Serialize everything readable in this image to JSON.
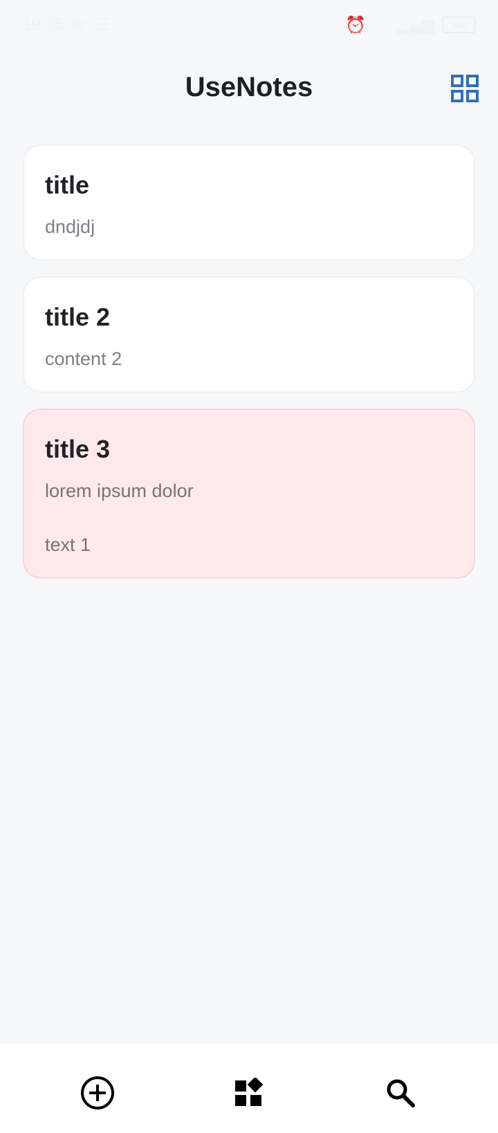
{
  "status_bar": {
    "time": "19:35",
    "battery": "100"
  },
  "header": {
    "title": "UseNotes",
    "layout_toggle_icon": "grid-view-icon",
    "accent_color": "#2f6fba"
  },
  "notes": [
    {
      "title": "title",
      "content": "dndjdj",
      "extra": "",
      "color": "#ffffff"
    },
    {
      "title": "title 2",
      "content": "content 2",
      "extra": "",
      "color": "#ffffff"
    },
    {
      "title": "title 3",
      "content": "lorem ipsum dolor",
      "extra": "text 1",
      "color": "#ffe9ec"
    }
  ],
  "bottom_nav": {
    "items": [
      {
        "icon": "add-circle-icon"
      },
      {
        "icon": "widgets-icon"
      },
      {
        "icon": "search-icon"
      }
    ]
  }
}
